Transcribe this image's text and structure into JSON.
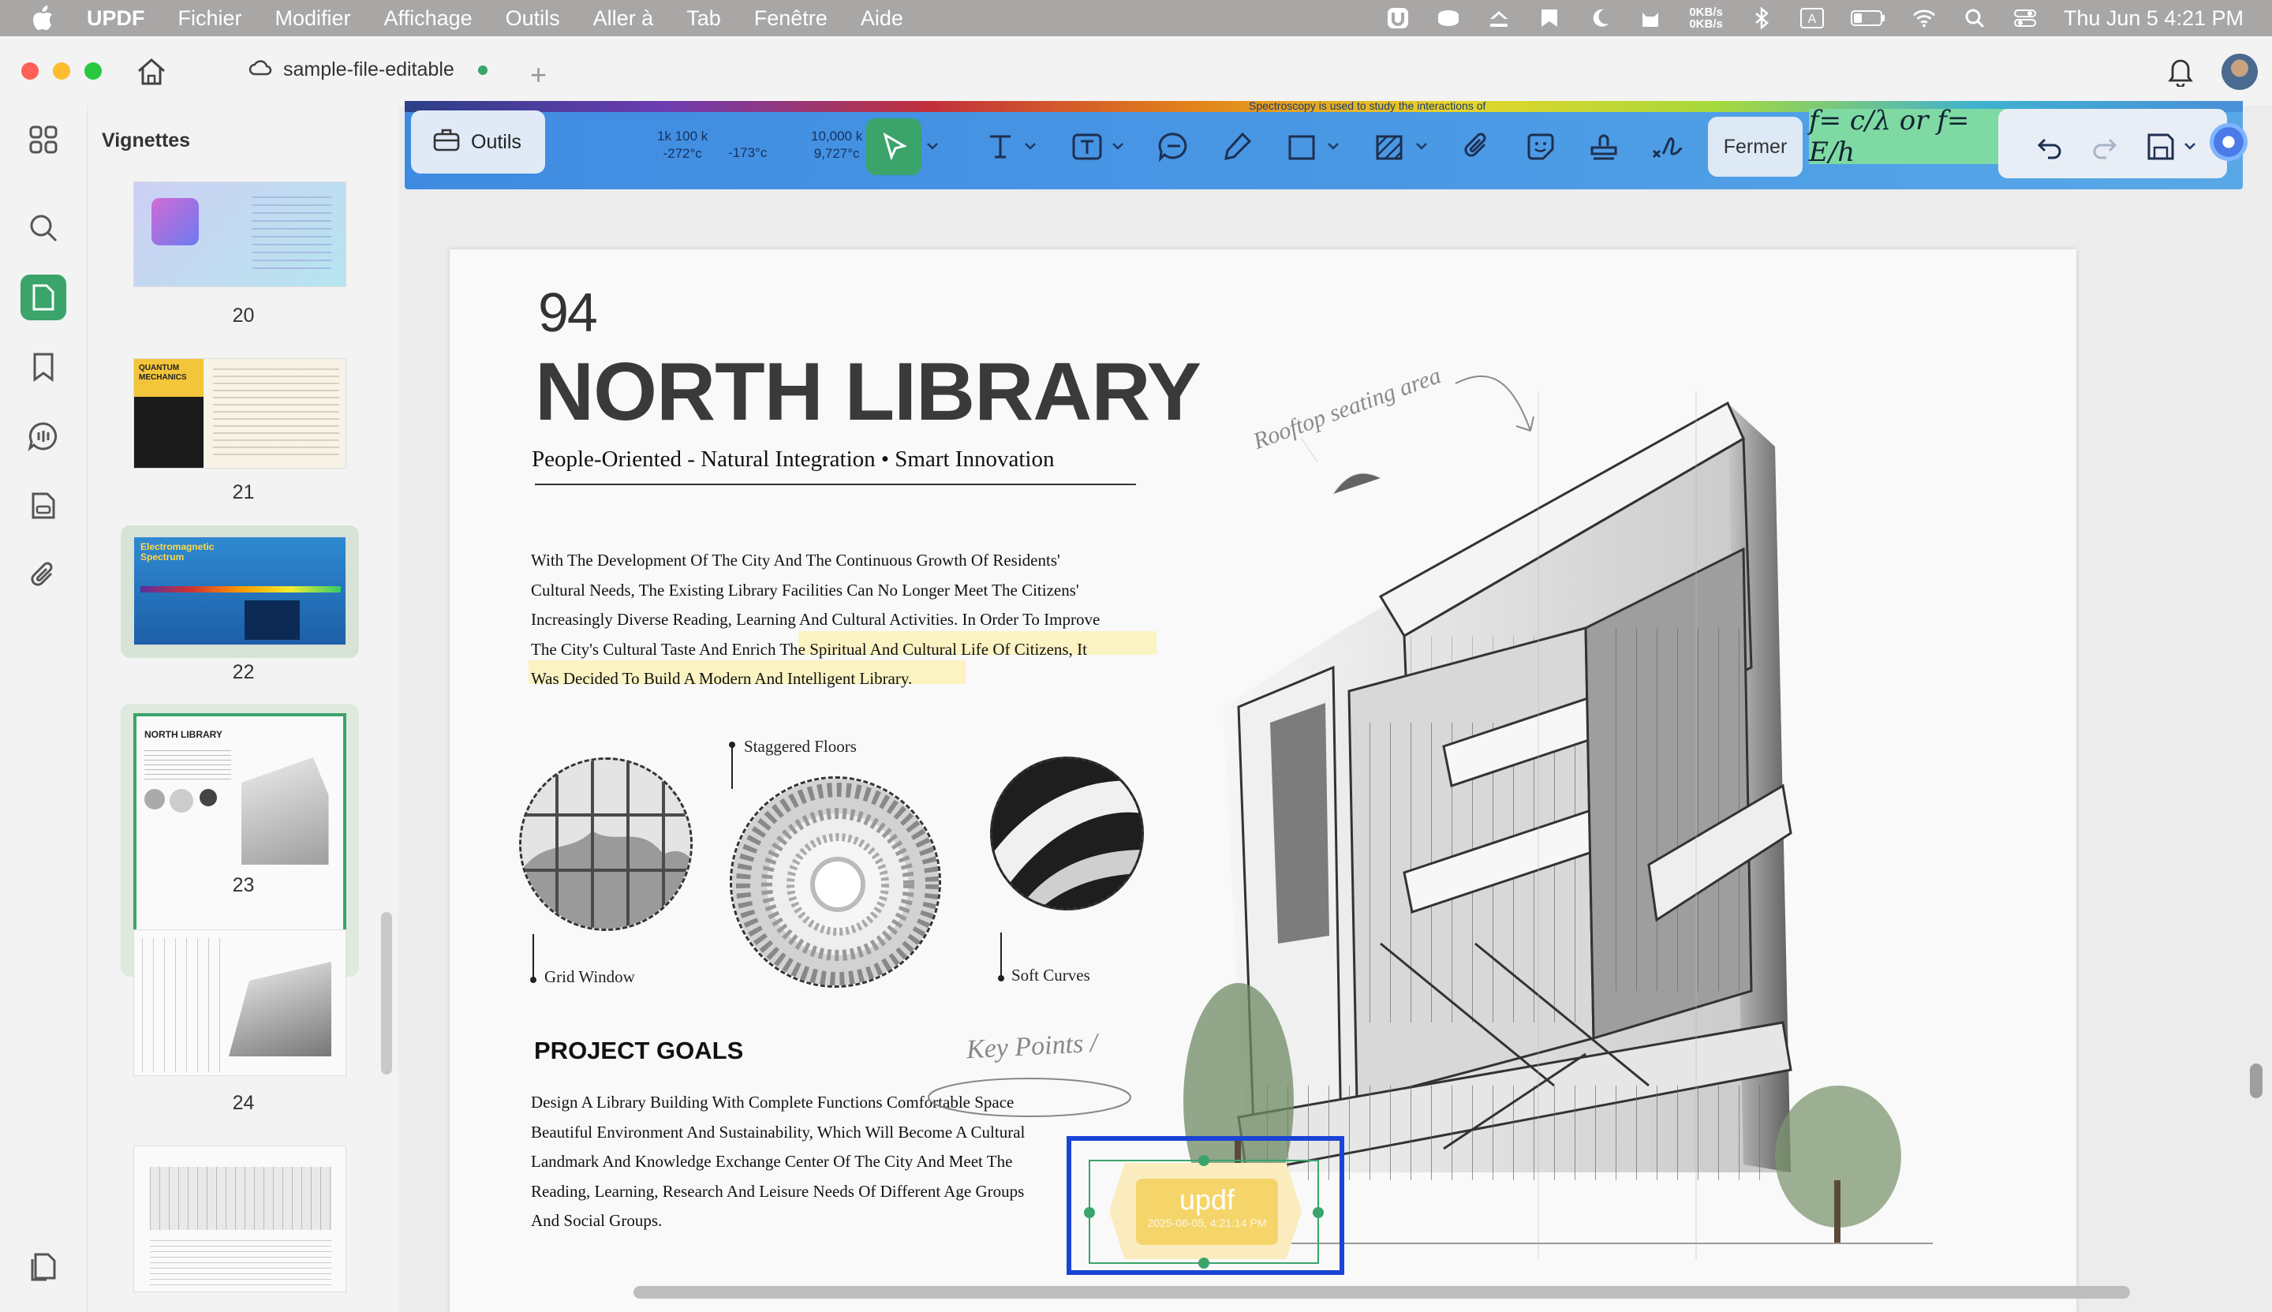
{
  "menubar": {
    "app_name": "UPDF",
    "items": [
      "Fichier",
      "Modifier",
      "Affichage",
      "Outils",
      "Aller à",
      "Tab",
      "Fenêtre",
      "Aide"
    ],
    "net_up": "0KB/s",
    "net_down": "0KB/s",
    "datetime": "Thu Jun 5  4:21 PM"
  },
  "titlebar": {
    "doc_tab": "sample-file-editable"
  },
  "panel": {
    "title": "Vignettes",
    "pages": [
      "20",
      "21",
      "22",
      "23",
      "24"
    ],
    "thumb21_text": "QUANTUM MECHANICS",
    "thumb22_text": "Electromagnetic Spectrum",
    "thumb23_text": "NORTH LIBRARY"
  },
  "toolbar": {
    "tools_label": "Outils",
    "close_label": "Fermer",
    "spectrum_labels": [
      "1k 100 k",
      "-272°c",
      "-173°c",
      "10,000 k",
      "9,727°c"
    ],
    "spectrum_note": "Spectroscopy is used to study the interactions of",
    "formula": "f= c/λ or f= E/h"
  },
  "document": {
    "page_number": "94",
    "title": "NORTH LIBRARY",
    "subtitle": "People-Oriented - Natural Integration • Smart Innovation",
    "intro_lines": [
      "With The Development Of The City And The Continuous Growth Of Residents'",
      "Cultural Needs, The Existing Library Facilities Can No Longer Meet The Citizens'",
      "Increasingly Diverse Reading, Learning And Cultural Activities. In Order To Improve",
      "The City's Cultural Taste And Enrich The Spiritual And Cultural Life Of Citizens, It",
      "Was Decided To Build A Modern And Intelligent Library."
    ],
    "labels": {
      "staggered": "Staggered Floors",
      "grid": "Grid Window",
      "soft": "Soft Curves"
    },
    "handwritten_rooftop": "Rooftop seating area",
    "handwritten_keypoints": "Key Points /",
    "goals_heading": "PROJECT GOALS",
    "goals_lines": [
      "Design A Library Building With Complete Functions Comfortable Space",
      "Beautiful Environment And Sustainability, Which Will Become A Cultural",
      "Landmark And Knowledge Exchange Center Of The City And Meet The",
      "Reading, Learning, Research And Leisure Needs Of Different Age Groups",
      "And Social Groups."
    ],
    "stamp_text": "updf",
    "stamp_date": "2025-06-05, 4:21:14 PM"
  },
  "colors": {
    "accent_green": "#3aa46b",
    "selection_blue": "#1a44d6",
    "highlight_yellow": "#fbf3c2",
    "stamp_fill": "#f5d56a"
  }
}
